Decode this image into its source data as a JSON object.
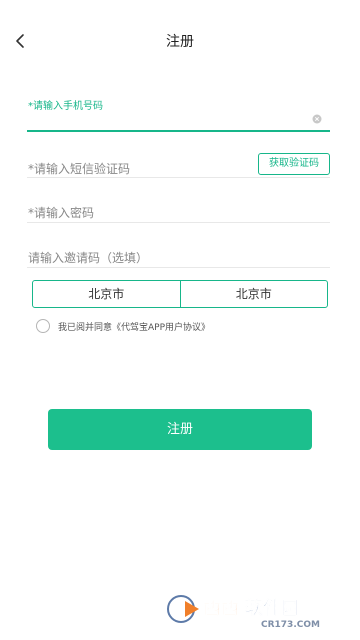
{
  "header": {
    "title": "注册"
  },
  "form": {
    "phone_placeholder": "*请输入手机号码",
    "sms_placeholder": "*请输入短信验证码",
    "get_code_label": "获取验证码",
    "password_placeholder": "*请输入密码",
    "invite_placeholder": "请输入邀请码（选填）",
    "province": "北京市",
    "city": "北京市",
    "agreement": "我已阅并同意《代驾宝APP用户协议》",
    "submit_label": "注册"
  },
  "colors": {
    "accent": "#1cbf8d"
  },
  "watermark": {
    "brand": "西西软件园",
    "domain": "CR173.COM"
  }
}
